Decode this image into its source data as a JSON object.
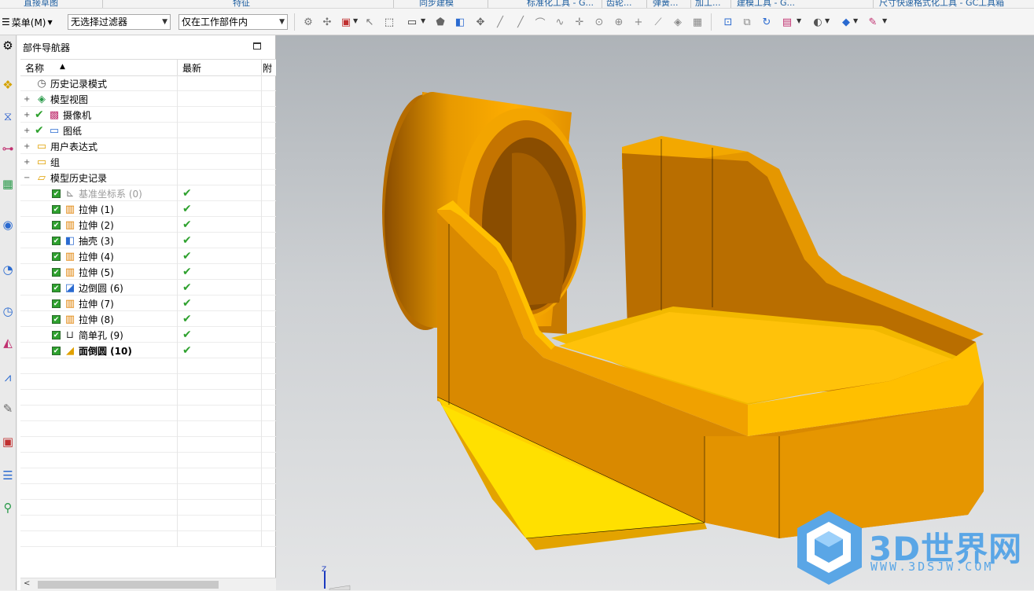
{
  "ribbon": {
    "groups": [
      "直接草图",
      "特征",
      "同步建模",
      "标准化工具 - G...",
      "齿轮...",
      "弹簧...",
      "加工...",
      "建模工具 - G...",
      "尺寸快速格式化工具 - GC工具箱"
    ]
  },
  "toolbar": {
    "menu_label": "菜单(M)",
    "filter_value": "无选择过滤器",
    "scope_value": "仅在工作部件内"
  },
  "navigator": {
    "title": "部件导航器",
    "columns": [
      "名称",
      "最新",
      "附"
    ],
    "rows": [
      {
        "label": "历史记录模式",
        "icon": "clock-icon",
        "indent": 1,
        "expand": "",
        "check": false,
        "latest": false,
        "bold": false,
        "dim": false
      },
      {
        "label": "模型视图",
        "icon": "model-views-icon",
        "indent": 1,
        "expand": "+",
        "check": false,
        "latest": false,
        "bold": false,
        "dim": false
      },
      {
        "label": "摄像机",
        "icon": "camera-icon",
        "indent": 1,
        "expand": "+",
        "check": true,
        "latest": false,
        "bold": false,
        "dim": false
      },
      {
        "label": "图纸",
        "icon": "drawing-icon",
        "indent": 1,
        "expand": "+",
        "check": true,
        "latest": false,
        "bold": false,
        "dim": false
      },
      {
        "label": "用户表达式",
        "icon": "folder-icon",
        "indent": 1,
        "expand": "+",
        "check": false,
        "latest": false,
        "bold": false,
        "dim": false
      },
      {
        "label": "组",
        "icon": "folder-icon",
        "indent": 1,
        "expand": "+",
        "check": false,
        "latest": false,
        "bold": false,
        "dim": false
      },
      {
        "label": "模型历史记录",
        "icon": "folder-open-icon",
        "indent": 1,
        "expand": "-",
        "check": false,
        "latest": false,
        "bold": false,
        "dim": false
      },
      {
        "label": "基准坐标系 (0)",
        "icon": "datum-csys-icon",
        "indent": 2,
        "expand": "",
        "check": true,
        "latest": true,
        "bold": false,
        "dim": true
      },
      {
        "label": "拉伸 (1)",
        "icon": "extrude-icon",
        "indent": 2,
        "expand": "",
        "check": true,
        "latest": true,
        "bold": false,
        "dim": false
      },
      {
        "label": "拉伸 (2)",
        "icon": "extrude-icon",
        "indent": 2,
        "expand": "",
        "check": true,
        "latest": true,
        "bold": false,
        "dim": false
      },
      {
        "label": "抽壳 (3)",
        "icon": "shell-icon",
        "indent": 2,
        "expand": "",
        "check": true,
        "latest": true,
        "bold": false,
        "dim": false
      },
      {
        "label": "拉伸 (4)",
        "icon": "extrude-icon",
        "indent": 2,
        "expand": "",
        "check": true,
        "latest": true,
        "bold": false,
        "dim": false
      },
      {
        "label": "拉伸 (5)",
        "icon": "extrude-icon",
        "indent": 2,
        "expand": "",
        "check": true,
        "latest": true,
        "bold": false,
        "dim": false
      },
      {
        "label": "边倒圆 (6)",
        "icon": "edge-blend-icon",
        "indent": 2,
        "expand": "",
        "check": true,
        "latest": true,
        "bold": false,
        "dim": false
      },
      {
        "label": "拉伸 (7)",
        "icon": "extrude-icon",
        "indent": 2,
        "expand": "",
        "check": true,
        "latest": true,
        "bold": false,
        "dim": false
      },
      {
        "label": "拉伸 (8)",
        "icon": "extrude-icon",
        "indent": 2,
        "expand": "",
        "check": true,
        "latest": true,
        "bold": false,
        "dim": false
      },
      {
        "label": "简单孔 (9)",
        "icon": "hole-icon",
        "indent": 2,
        "expand": "",
        "check": true,
        "latest": true,
        "bold": false,
        "dim": false
      },
      {
        "label": "面倒圆 (10)",
        "icon": "face-blend-icon",
        "indent": 2,
        "expand": "",
        "check": true,
        "latest": true,
        "bold": true,
        "dim": false
      }
    ]
  },
  "viewport": {
    "triad_label": "Z",
    "watermark_title": "3D世界网",
    "watermark_url": "WWW.3DSJW.COM",
    "model_color": "#F0A000"
  }
}
